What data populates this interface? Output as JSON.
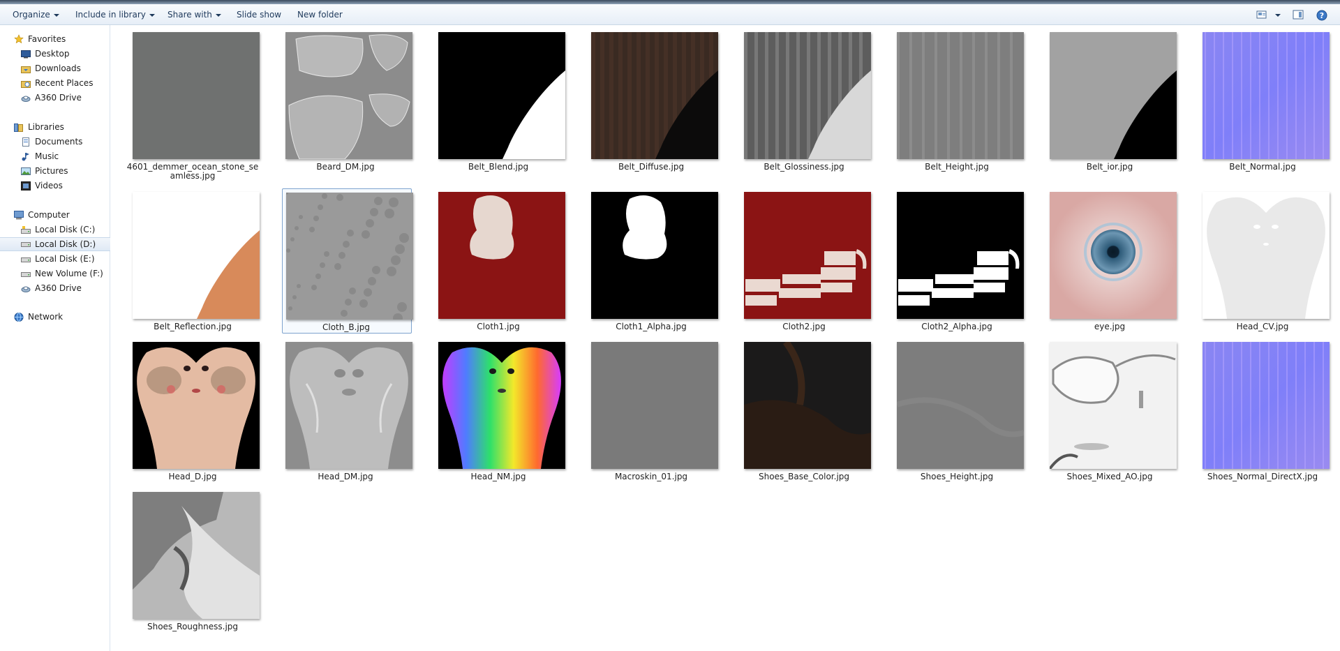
{
  "toolbar": {
    "organize": "Organize",
    "include_in_library": "Include in library",
    "share_with": "Share with",
    "slide_show": "Slide show",
    "new_folder": "New folder"
  },
  "sidebar": {
    "favorites": {
      "label": "Favorites",
      "icon": "star-icon"
    },
    "favorites_items": [
      {
        "label": "Desktop",
        "icon": "desktop-icon"
      },
      {
        "label": "Downloads",
        "icon": "downloads-icon"
      },
      {
        "label": "Recent Places",
        "icon": "recent-places-icon"
      },
      {
        "label": "A360 Drive",
        "icon": "cloud-drive-icon"
      }
    ],
    "libraries": {
      "label": "Libraries",
      "icon": "libraries-icon"
    },
    "libraries_items": [
      {
        "label": "Documents",
        "icon": "documents-icon"
      },
      {
        "label": "Music",
        "icon": "music-icon"
      },
      {
        "label": "Pictures",
        "icon": "pictures-icon"
      },
      {
        "label": "Videos",
        "icon": "videos-icon"
      }
    ],
    "computer": {
      "label": "Computer",
      "icon": "computer-icon"
    },
    "computer_items": [
      {
        "label": "Local Disk (C:)",
        "icon": "drive-icon"
      },
      {
        "label": "Local Disk (D:)",
        "icon": "drive-icon",
        "selected": true
      },
      {
        "label": "Local Disk (E:)",
        "icon": "drive-icon"
      },
      {
        "label": "New Volume (F:)",
        "icon": "drive-icon"
      },
      {
        "label": "A360 Drive",
        "icon": "cloud-drive-icon"
      }
    ],
    "network": {
      "label": "Network",
      "icon": "network-icon"
    }
  },
  "files": [
    {
      "name": "4601_demmer_ocean_stone_seamless.jpg",
      "preview": "stone"
    },
    {
      "name": "Beard_DM.jpg",
      "preview": "beard"
    },
    {
      "name": "Belt_Blend.jpg",
      "preview": "belt-blend"
    },
    {
      "name": "Belt_Diffuse.jpg",
      "preview": "belt-diffuse"
    },
    {
      "name": "Belt_Glossiness.jpg",
      "preview": "belt-gloss"
    },
    {
      "name": "Belt_Height.jpg",
      "preview": "belt-height"
    },
    {
      "name": "Belt_ior.jpg",
      "preview": "belt-ior"
    },
    {
      "name": "Belt_Normal.jpg",
      "preview": "normal"
    },
    {
      "name": "Belt_Reflection.jpg",
      "preview": "belt-reflection"
    },
    {
      "name": "Cloth_B.jpg",
      "preview": "cloth-b",
      "selected": true
    },
    {
      "name": "Cloth1.jpg",
      "preview": "cloth1"
    },
    {
      "name": "Cloth1_Alpha.jpg",
      "preview": "cloth1-alpha"
    },
    {
      "name": "Cloth2.jpg",
      "preview": "cloth2"
    },
    {
      "name": "Cloth2_Alpha.jpg",
      "preview": "cloth2-alpha"
    },
    {
      "name": "eye.jpg",
      "preview": "eye"
    },
    {
      "name": "Head_CV.jpg",
      "preview": "head-cv"
    },
    {
      "name": "Head_D.jpg",
      "preview": "head-d"
    },
    {
      "name": "Head_DM.jpg",
      "preview": "head-dm"
    },
    {
      "name": "Head_NM.jpg",
      "preview": "head-nm"
    },
    {
      "name": "Macroskin_01.jpg",
      "preview": "macroskin"
    },
    {
      "name": "Shoes_Base_Color.jpg",
      "preview": "shoes-base"
    },
    {
      "name": "Shoes_Height.jpg",
      "preview": "shoes-height"
    },
    {
      "name": "Shoes_Mixed_AO.jpg",
      "preview": "shoes-ao"
    },
    {
      "name": "Shoes_Normal_DirectX.jpg",
      "preview": "normal2"
    },
    {
      "name": "Shoes_Roughness.jpg",
      "preview": "shoes-rough"
    }
  ]
}
